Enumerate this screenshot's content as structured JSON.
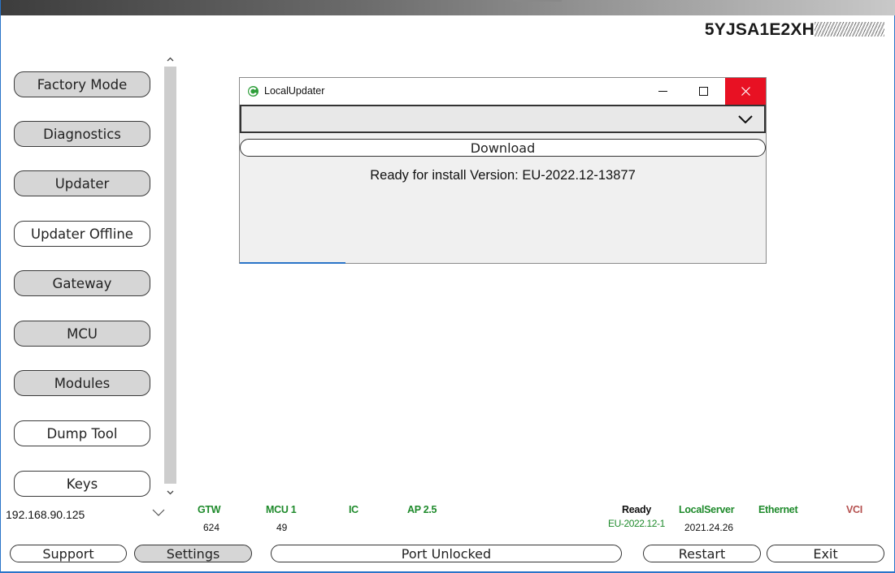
{
  "vin": {
    "visible": "5YJSA1E2XH"
  },
  "sidebar": {
    "items": [
      {
        "label": "Factory Mode",
        "style": "gray"
      },
      {
        "label": "Diagnostics",
        "style": "gray"
      },
      {
        "label": "Updater",
        "style": "gray"
      },
      {
        "label": "Updater Offline",
        "style": "white"
      },
      {
        "label": "Gateway",
        "style": "gray"
      },
      {
        "label": "MCU",
        "style": "gray"
      },
      {
        "label": "Modules",
        "style": "gray"
      },
      {
        "label": "Dump Tool",
        "style": "white"
      },
      {
        "label": "Keys",
        "style": "white"
      }
    ]
  },
  "dialog": {
    "title": "LocalUpdater",
    "minimize": "–",
    "maximize": "□",
    "close": "×",
    "download_label": "Download",
    "status": "Ready for install Version: EU-2022.12-13877"
  },
  "network": {
    "ip": "192.168.90.125"
  },
  "status": {
    "gtw_label": "GTW",
    "gtw_value": "624",
    "mcu_label": "MCU 1",
    "mcu_value": "49",
    "ic_label": "IC",
    "ap_label": "AP 2.5",
    "ready_label": "Ready",
    "ready_value": "EU-2022.12-1",
    "localserver_label": "LocalServer",
    "localserver_value": "2021.24.26",
    "ethernet_label": "Ethernet",
    "vci_label": "VCI"
  },
  "bottom": {
    "support": "Support",
    "settings": "Settings",
    "port": "Port Unlocked",
    "restart": "Restart",
    "exit": "Exit"
  },
  "colors": {
    "accent": "#2a74c8",
    "ok_green": "#1e8a2b",
    "vci_red": "#b5514f",
    "close_red": "#e81123",
    "logo_green": "#2e9e3a"
  }
}
